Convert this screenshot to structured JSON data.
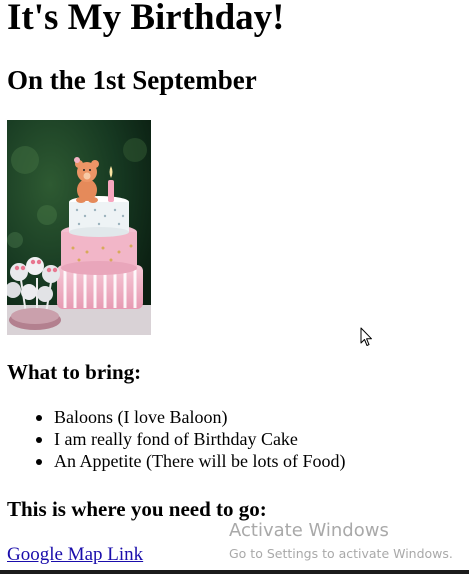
{
  "page": {
    "title": "It's My Birthday!",
    "subtitle": "On the 1st September",
    "photo_icon": "birthday-cake-image"
  },
  "bring": {
    "heading": "What to bring:",
    "items": [
      {
        "label": "Baloons (I love Baloon)"
      },
      {
        "label": "I am really fond of Birthday Cake"
      },
      {
        "label": "An Appetite (There will be lots of Food)"
      }
    ]
  },
  "directions": {
    "heading": "This is where you need to go:",
    "link_label": "Google Map Link"
  },
  "watermark": {
    "title": "Activate Windows",
    "subtitle": "Go to Settings to activate Windows."
  },
  "colors": {
    "link": "#1a0dab",
    "watermark": "#a9a9a9",
    "taskbar": "#1c1c1c"
  }
}
